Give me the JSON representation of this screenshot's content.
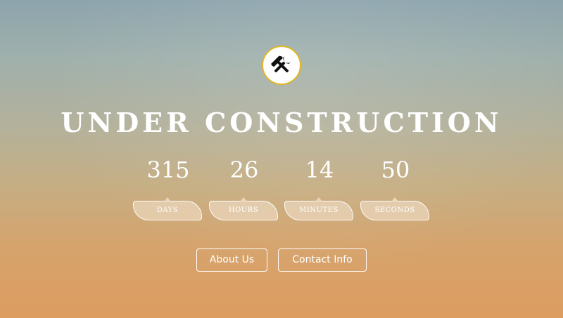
{
  "page": {
    "title": "UNDER CONSTRUCTION"
  },
  "logo": {
    "icon": "hammer-wrench-icon",
    "ring_color": "#e2b726"
  },
  "countdown": {
    "days": {
      "value": "315",
      "label": "DAYS"
    },
    "hours": {
      "value": "26",
      "label": "HOURS"
    },
    "minutes": {
      "value": "14",
      "label": "MINUTES"
    },
    "seconds": {
      "value": "50",
      "label": "SECONDS"
    }
  },
  "buttons": {
    "about_label": "About Us",
    "contact_label": "Contact Info"
  }
}
